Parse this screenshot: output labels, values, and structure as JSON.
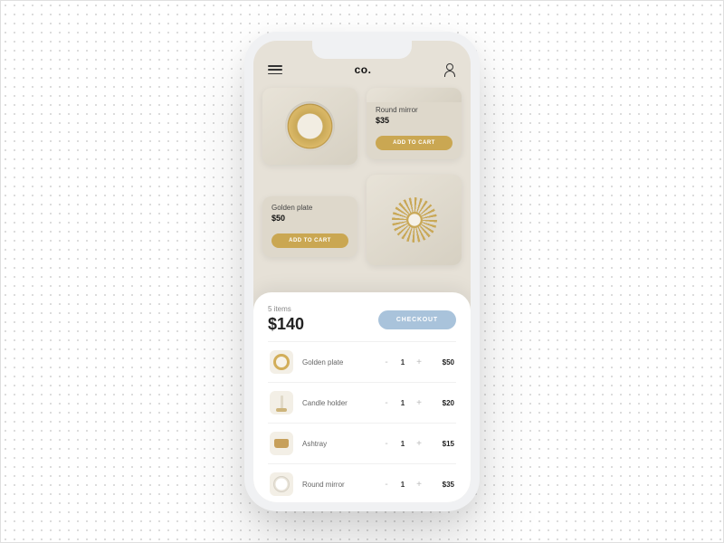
{
  "header": {
    "brand": "co."
  },
  "products": [
    {
      "name": "Round mirror",
      "price": "$35",
      "btn": "ADD TO CART"
    },
    {
      "name": "Golden plate",
      "price": "$50",
      "btn": "ADD TO CART"
    }
  ],
  "cart": {
    "count_label": "5 items",
    "total": "$140",
    "checkout_label": "CHECKOUT",
    "items": [
      {
        "name": "Golden plate",
        "qty": "1",
        "price": "$50"
      },
      {
        "name": "Candle holder",
        "qty": "1",
        "price": "$20"
      },
      {
        "name": "Ashtray",
        "qty": "1",
        "price": "$15"
      },
      {
        "name": "Round mirror",
        "qty": "1",
        "price": "$35"
      }
    ]
  }
}
